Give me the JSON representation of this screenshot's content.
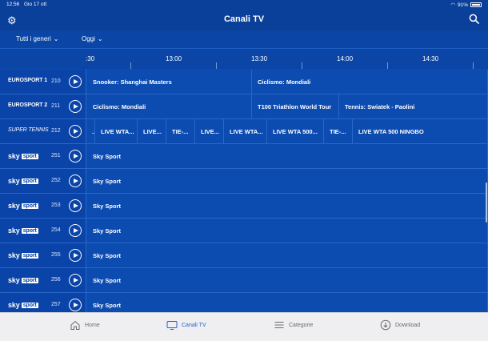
{
  "status": {
    "time": "12:56",
    "date": "Gio 17 ott",
    "battery": "91%"
  },
  "header": {
    "title": "Canali TV"
  },
  "filters": {
    "genre": "Tutti i generi",
    "day": "Oggi"
  },
  "timeline": {
    "ticks": [
      ":30",
      "13:00",
      "13:30",
      "14:00",
      "14:30"
    ]
  },
  "channels": [
    {
      "logo": "EUROSPORT 1",
      "number": "210",
      "programs": [
        "Snooker: Shanghai Masters",
        "Ciclismo: Mondiali"
      ]
    },
    {
      "logo": "EUROSPORT 2",
      "number": "211",
      "programs": [
        "Ciclismo: Mondiali",
        "T100 Triathlon World Tour",
        "Tennis: Swiatek - Paolini"
      ]
    },
    {
      "logo": "SUPER TENNIS",
      "number": "212",
      "programs": [
        "...",
        "LIVE WTA...",
        "LIVE...",
        "TIE-...",
        "LIVE...",
        "LIVE WTA...",
        "LIVE WTA 500...",
        "TIE-...",
        "LIVE WTA 500 NINGBO"
      ]
    },
    {
      "logo_a": "sky",
      "logo_b": "sport",
      "number": "251",
      "programs": [
        "Sky Sport"
      ]
    },
    {
      "logo_a": "sky",
      "logo_b": "sport",
      "number": "252",
      "programs": [
        "Sky Sport"
      ]
    },
    {
      "logo_a": "sky",
      "logo_b": "sport",
      "number": "253",
      "programs": [
        "Sky Sport"
      ]
    },
    {
      "logo_a": "sky",
      "logo_b": "sport",
      "number": "254",
      "programs": [
        "Sky Sport"
      ]
    },
    {
      "logo_a": "sky",
      "logo_b": "sport",
      "number": "255",
      "programs": [
        "Sky Sport"
      ]
    },
    {
      "logo_a": "sky",
      "logo_b": "sport",
      "number": "256",
      "programs": [
        "Sky Sport"
      ]
    },
    {
      "logo_a": "sky",
      "logo_b": "sport",
      "number": "257",
      "programs": [
        "Sky Sport"
      ]
    }
  ],
  "nav": {
    "items": [
      {
        "label": "Home",
        "icon": "home-icon"
      },
      {
        "label": "Canali TV",
        "icon": "tv-icon"
      },
      {
        "label": "Categorie",
        "icon": "menu-icon"
      },
      {
        "label": "Download",
        "icon": "download-icon"
      }
    ]
  },
  "colors": {
    "accent": "#1e5fd0",
    "background": "#0c4bb0"
  }
}
